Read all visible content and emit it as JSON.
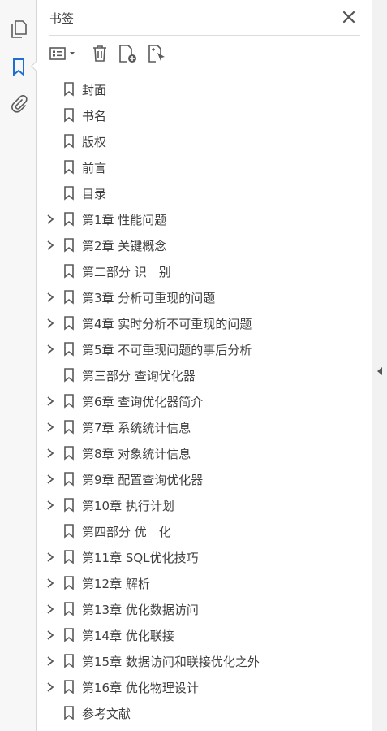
{
  "panel": {
    "title": "书签"
  },
  "bookmarks": [
    {
      "label": "封面",
      "expandable": false
    },
    {
      "label": "书名",
      "expandable": false
    },
    {
      "label": "版权",
      "expandable": false
    },
    {
      "label": "前言",
      "expandable": false
    },
    {
      "label": "目录",
      "expandable": false
    },
    {
      "label": "第1章 性能问题",
      "expandable": true
    },
    {
      "label": "第2章 关键概念",
      "expandable": true
    },
    {
      "label": "第二部分 识　别",
      "expandable": false
    },
    {
      "label": "第3章 分析可重现的问题",
      "expandable": true
    },
    {
      "label": "第4章 实时分析不可重现的问题",
      "expandable": true
    },
    {
      "label": "第5章 不可重现问题的事后分析",
      "expandable": true
    },
    {
      "label": "第三部分 查询优化器",
      "expandable": false
    },
    {
      "label": "第6章 查询优化器简介",
      "expandable": true
    },
    {
      "label": "第7章 系统统计信息",
      "expandable": true
    },
    {
      "label": "第8章 对象统计信息",
      "expandable": true
    },
    {
      "label": "第9章 配置查询优化器",
      "expandable": true
    },
    {
      "label": "第10章 执行计划",
      "expandable": true
    },
    {
      "label": "第四部分 优　化",
      "expandable": false
    },
    {
      "label": "第11章 SQL优化技巧",
      "expandable": true
    },
    {
      "label": "第12章 解析",
      "expandable": true
    },
    {
      "label": "第13章 优化数据访问",
      "expandable": true
    },
    {
      "label": "第14章 优化联接",
      "expandable": true
    },
    {
      "label": "第15章 数据访问和联接优化之外",
      "expandable": true
    },
    {
      "label": "第16章 优化物理设计",
      "expandable": true
    },
    {
      "label": "参考文献",
      "expandable": false
    }
  ],
  "colors": {
    "accent": "#1f6fd1",
    "icon": "#5a5a5a",
    "text": "#3f3f3f"
  }
}
